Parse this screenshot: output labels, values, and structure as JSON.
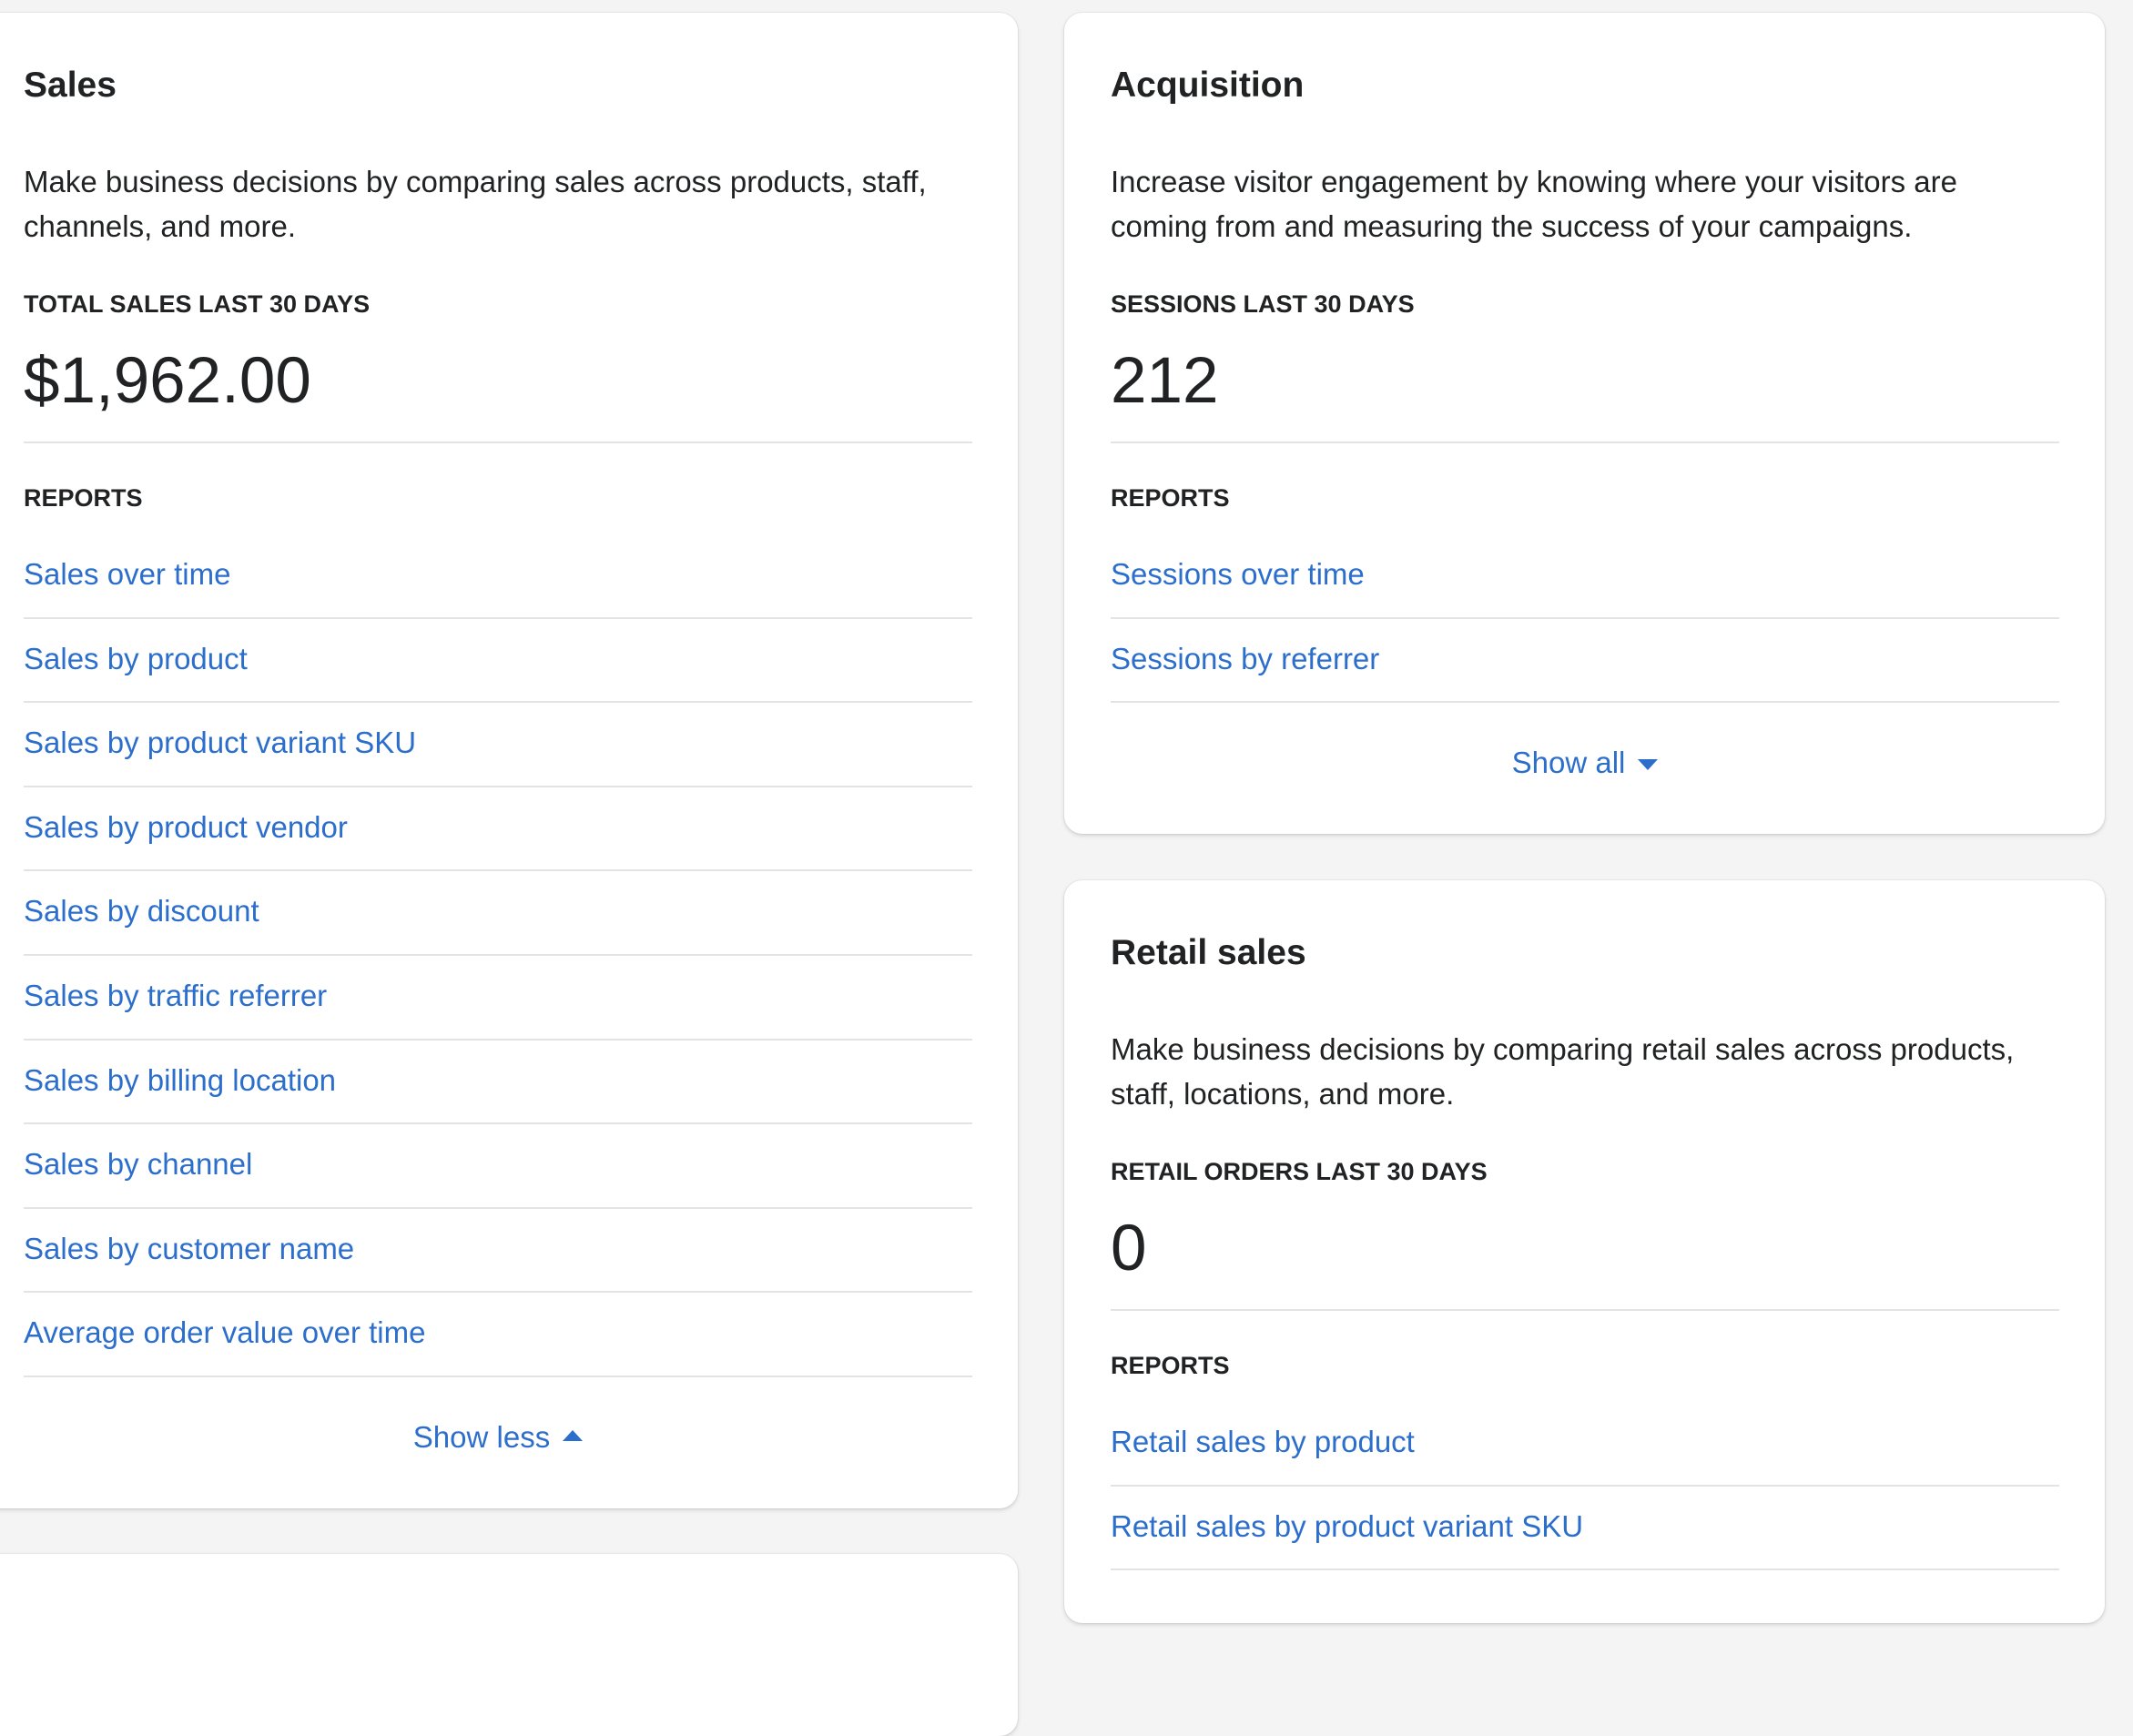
{
  "colors": {
    "background": "#f4f4f4",
    "card": "#ffffff",
    "text": "#202223",
    "link": "#2c6ecb",
    "divider": "#e1e3e5"
  },
  "sales": {
    "title": "Sales",
    "description": "Make business decisions by comparing sales across products, staff, channels, and more.",
    "stat_label": "TOTAL SALES LAST 30 DAYS",
    "stat_value": "$1,962.00",
    "reports_label": "REPORTS",
    "reports": [
      "Sales over time",
      "Sales by product",
      "Sales by product variant SKU",
      "Sales by product vendor",
      "Sales by discount",
      "Sales by traffic referrer",
      "Sales by billing location",
      "Sales by channel",
      "Sales by customer name",
      "Average order value over time"
    ],
    "toggle_label": "Show less",
    "toggle_icon": "caret-up-icon"
  },
  "acquisition": {
    "title": "Acquisition",
    "description": "Increase visitor engagement by knowing where your visitors are coming from and measuring the success of your campaigns.",
    "stat_label": "SESSIONS LAST 30 DAYS",
    "stat_value": "212",
    "reports_label": "REPORTS",
    "reports": [
      "Sessions over time",
      "Sessions by referrer"
    ],
    "toggle_label": "Show all",
    "toggle_icon": "caret-down-icon"
  },
  "retail_sales": {
    "title": "Retail sales",
    "description": "Make business decisions by comparing retail sales across products, staff, locations, and more.",
    "stat_label": "RETAIL ORDERS LAST 30 DAYS",
    "stat_value": "0",
    "reports_label": "REPORTS",
    "reports": [
      "Retail sales by product",
      "Retail sales by product variant SKU"
    ]
  }
}
